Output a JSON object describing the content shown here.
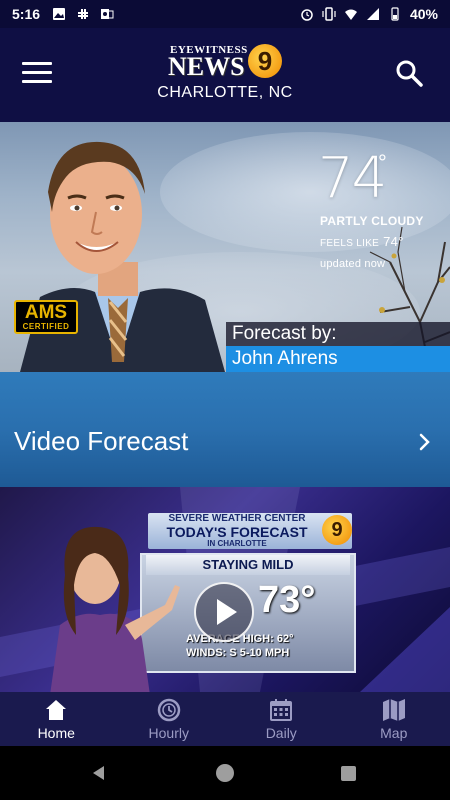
{
  "status_bar": {
    "time": "5:16",
    "battery": "40%",
    "left_icons": [
      "image-icon",
      "slack-icon",
      "outlook-icon"
    ],
    "right_icons": [
      "alarm-icon",
      "vibrate-icon",
      "wifi-icon",
      "signal-icon",
      "battery-icon"
    ]
  },
  "header": {
    "logo": {
      "line1": "EYEWITNESS",
      "line2": "NEWS",
      "channel": "9"
    },
    "location": "CHARLOTTE, NC",
    "menu_icon": "hamburger-menu-icon",
    "search_icon": "search-icon"
  },
  "hero": {
    "temperature": "74",
    "degree_symbol": "°",
    "condition": "PARTLY CLOUDY",
    "feels_like_label": "FEELS LIKE",
    "feels_like_value": "74°",
    "updated": "updated now",
    "badge": {
      "top": "AMS",
      "bottom": "CERTIFIED"
    },
    "forecast_by_label": "Forecast by:",
    "meteorologist": "John Ahrens"
  },
  "video_forecast": {
    "label": "Video Forecast",
    "chevron_icon": "chevron-right-icon"
  },
  "video_thumbnail": {
    "banner_line1": "SEVERE WEATHER CENTER",
    "banner_line2": "TODAY'S FORECAST",
    "banner_line3": "IN CHARLOTTE",
    "channel": "9",
    "headline": "STAYING MILD",
    "big_temp": "73°",
    "average_high": "AVERAGE HIGH: 62°",
    "winds": "WINDS:  S 5-10 MPH",
    "play_icon": "play-icon"
  },
  "bottom_nav": {
    "items": [
      {
        "label": "Home",
        "icon": "home-icon",
        "active": true
      },
      {
        "label": "Hourly",
        "icon": "clock-icon",
        "active": false
      },
      {
        "label": "Daily",
        "icon": "calendar-icon",
        "active": false
      },
      {
        "label": "Map",
        "icon": "map-icon",
        "active": false
      }
    ]
  },
  "colors": {
    "header_bg": "#0f0f44",
    "accent_blue": "#1d8fe3",
    "nav_bg": "#1a1a4e",
    "nav_inactive": "#9c9cc4"
  }
}
